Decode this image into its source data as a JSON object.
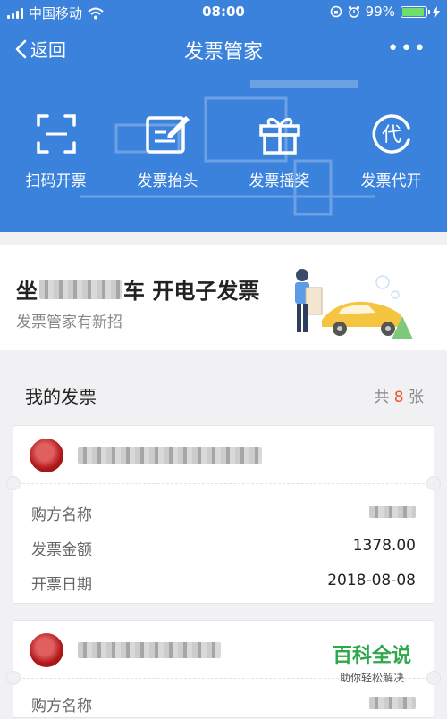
{
  "status": {
    "carrier": "中国移动",
    "time": "08:00",
    "battery": "99%"
  },
  "nav": {
    "back_label": "返回",
    "title": "发票管家",
    "more_label": "•••"
  },
  "quick_actions": [
    {
      "label": "扫码开票",
      "icon": "scan-icon"
    },
    {
      "label": "发票抬头",
      "icon": "edit-icon"
    },
    {
      "label": "发票摇奖",
      "icon": "gift-icon"
    },
    {
      "label": "发票代开",
      "icon": "proxy-icon"
    }
  ],
  "promo": {
    "title_suffix": "车 开电子发票",
    "title_prefix": "坐",
    "subtitle": "发票管家有新招"
  },
  "section": {
    "title": "我的发票",
    "count_prefix": "共",
    "count": "8",
    "count_suffix": "张"
  },
  "invoices": [
    {
      "buyer_label": "购方名称",
      "amount_label": "发票金额",
      "amount": "1378.00",
      "date_label": "开票日期",
      "date": "2018-08-08"
    },
    {
      "buyer_label": "购方名称"
    }
  ],
  "watermark": {
    "main": "百科全说",
    "sub": "助你轻松解决"
  },
  "colors": {
    "header": "#3b82dc",
    "accent": "#f0562a",
    "watermark": "#2ea84a"
  }
}
